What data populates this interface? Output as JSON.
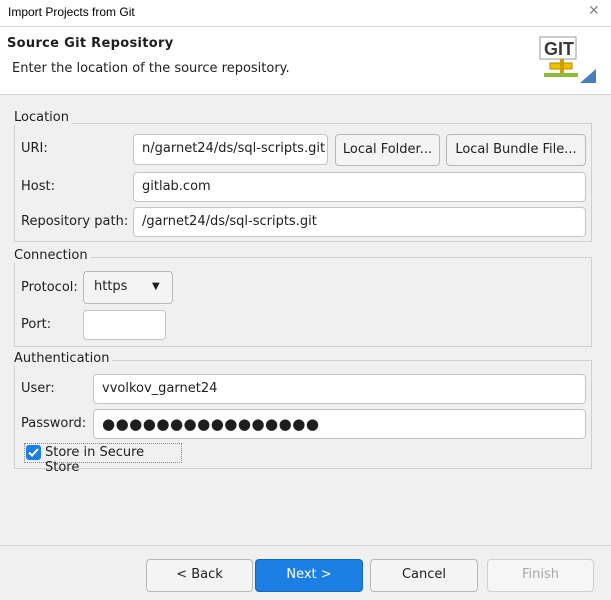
{
  "window": {
    "title": "Import Projects from Git"
  },
  "banner": {
    "title": "Source Git Repository",
    "description": "Enter the location of the source repository.",
    "logo_text": "GIT"
  },
  "location": {
    "legend": "Location",
    "uri_label": "URI:",
    "uri_value": "n/garnet24/ds/sql-scripts.git",
    "local_folder_button": "Local Folder...",
    "local_bundle_button": "Local Bundle File...",
    "host_label": "Host:",
    "host_value": "gitlab.com",
    "repo_path_label": "Repository path:",
    "repo_path_value": "/garnet24/ds/sql-scripts.git"
  },
  "connection": {
    "legend": "Connection",
    "protocol_label": "Protocol:",
    "protocol_value": "https",
    "port_label": "Port:",
    "port_value": ""
  },
  "authentication": {
    "legend": "Authentication",
    "user_label": "User:",
    "user_value": "vvolkov_garnet24",
    "password_label": "Password:",
    "password_value": "●●●●●●●●●●●●●●●●",
    "store_label": "Store in Secure Store",
    "store_checked": true
  },
  "buttons": {
    "back": "< Back",
    "next": "Next >",
    "cancel": "Cancel",
    "finish": "Finish"
  },
  "colors": {
    "primary": "#1c7fe3",
    "checkbox": "#1c7fe3"
  }
}
